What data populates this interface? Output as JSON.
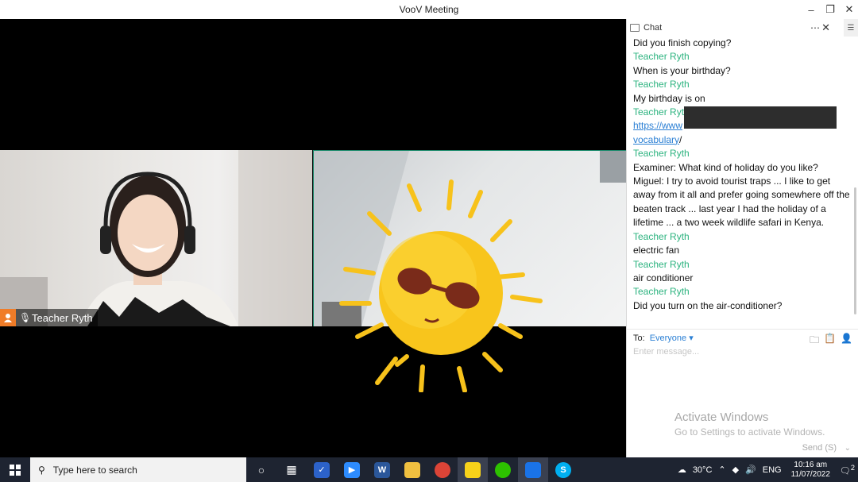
{
  "window": {
    "title": "VooV Meeting"
  },
  "participants": [
    {
      "name": "Teacher Ryth"
    }
  ],
  "chat": {
    "header": "Chat",
    "messages": [
      {
        "type": "text",
        "text": "Did you finish copying?"
      },
      {
        "type": "sender",
        "text": "Teacher Ryth"
      },
      {
        "type": "text",
        "text": "When is your birthday?"
      },
      {
        "type": "sender",
        "text": "Teacher Ryth"
      },
      {
        "type": "text",
        "text": "My birthday is on"
      },
      {
        "type": "sender",
        "text": "Teacher Ryt"
      },
      {
        "type": "link",
        "text": "https://www"
      },
      {
        "type": "link2",
        "text": "vocabulary",
        "suffix": "/"
      },
      {
        "type": "sender",
        "text": "Teacher Ryth"
      },
      {
        "type": "text",
        "text": "Examiner: What kind of holiday do you like?"
      },
      {
        "type": "text",
        "text": "Miguel: I try to avoid tourist traps ... I like to get"
      },
      {
        "type": "text",
        "text": "away from it all and prefer going somewhere off the"
      },
      {
        "type": "text",
        "text": "beaten track ... last year I had the holiday of a"
      },
      {
        "type": "text",
        "text": "lifetime ... a two week wildlife safari in Kenya."
      },
      {
        "type": "sender",
        "text": "Teacher Ryth"
      },
      {
        "type": "text",
        "text": "electric fan"
      },
      {
        "type": "sender",
        "text": "Teacher Ryth"
      },
      {
        "type": "text",
        "text": "air conditioner"
      },
      {
        "type": "sender",
        "text": "Teacher Ryth"
      },
      {
        "type": "text",
        "text": "Did you turn on the air-conditioner?"
      }
    ],
    "to_label": "To:",
    "recipient": "Everyone",
    "input_placeholder": "Enter message...",
    "send_label": "Send (S)"
  },
  "watermark": {
    "title": "Activate Windows",
    "subtitle": "Go to Settings to activate Windows."
  },
  "taskbar": {
    "search_placeholder": "Type here to search",
    "temperature": "30°C",
    "language": "ENG",
    "time": "10:16 am",
    "date": "11/07/2022",
    "notification_count": "2"
  }
}
